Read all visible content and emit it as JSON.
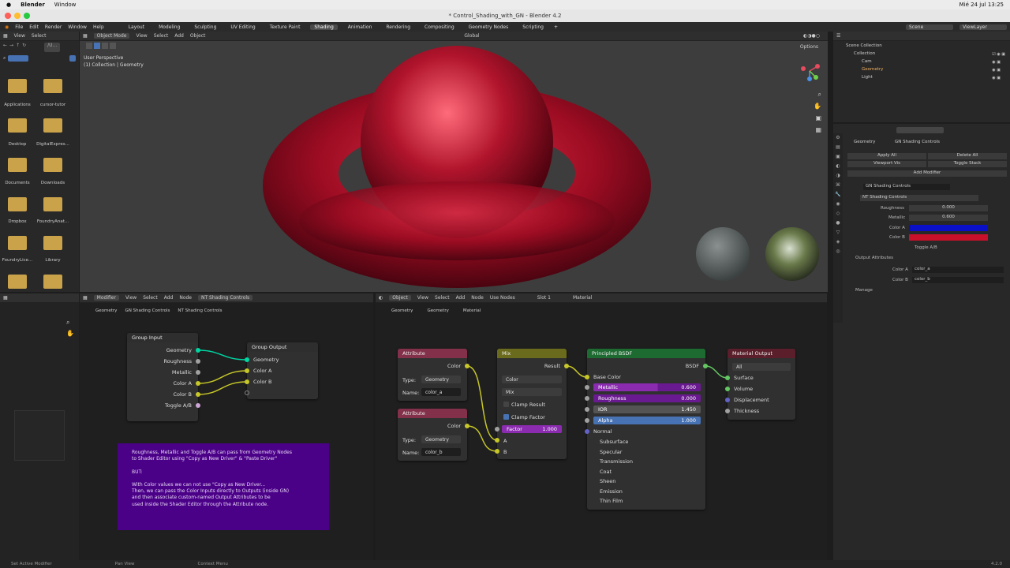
{
  "mac": {
    "apple": "",
    "app": "Blender",
    "window": "Window",
    "datetime": "Mié 24 jul 13:25"
  },
  "window_title": "* Control_Shading_with_GN - Blender 4.2",
  "menu": [
    "File",
    "Edit",
    "Render",
    "Window",
    "Help"
  ],
  "workspaces": [
    "Layout",
    "Modeling",
    "Sculpting",
    "UV Editing",
    "Texture Paint",
    "Shading",
    "Animation",
    "Rendering",
    "Compositing",
    "Geometry Nodes",
    "Scripting"
  ],
  "active_workspace": "Shading",
  "topright": {
    "scene": "Scene",
    "view_layer": "ViewLayer"
  },
  "filebrowser": {
    "view": "View",
    "select": "Select",
    "path": "/U...",
    "items": [
      "Applications",
      "cursor-tutor",
      "Desktop",
      "DigitalExpres...",
      "Documents",
      "Downloads",
      "Dropbox",
      "FoundryAnat...",
      "FoundryLice...",
      "Library"
    ]
  },
  "viewport": {
    "mode": "Object Mode",
    "menus": [
      "View",
      "Select",
      "Add",
      "Object"
    ],
    "transform": "Global",
    "info1": "User Perspective",
    "info2": "(1) Collection | Geometry",
    "options": "Options"
  },
  "outliner": {
    "root": "Scene Collection",
    "collection": "Collection",
    "items": [
      "Cam",
      "Geometry",
      "Light"
    ]
  },
  "properties": {
    "breadcrumb1": "Geometry",
    "breadcrumb2": "GN Shading Controls",
    "apply_all": "Apply All",
    "delete_all": "Delete All",
    "viewport_vis": "Viewport Vis",
    "toggle_stack": "Toggle Stack",
    "add_modifier": "Add Modifier",
    "modifier": "GN Shading Controls",
    "nodegroup": "NT Shading Controls",
    "roughness_label": "Roughness",
    "roughness": "0.000",
    "metallic_label": "Metallic",
    "metallic": "0.600",
    "color_a": "Color A",
    "color_b": "Color B",
    "toggle": "Toggle A/B",
    "output_attrs": "Output Attributes",
    "out_a_label": "Color A",
    "out_a": "color_a",
    "out_b_label": "Color B",
    "out_b": "color_b",
    "manage": "Manage",
    "color_a_hex": "#0a10c8",
    "color_b_hex": "#c8102a"
  },
  "geo_editor": {
    "header": [
      "Modifier",
      "View",
      "Select",
      "Add",
      "Node"
    ],
    "tree": "NT Shading Controls",
    "breadcrumb": [
      "Geometry",
      "GN Shading Controls",
      "NT Shading Controls"
    ],
    "group_input": {
      "title": "Group Input",
      "outs": [
        "Geometry",
        "Roughness",
        "Metallic",
        "Color A",
        "Color B",
        "Toggle A/B"
      ]
    },
    "group_output": {
      "title": "Group Output",
      "ins": [
        "Geometry",
        "Color A",
        "Color B"
      ]
    },
    "note": [
      "Roughness, Metallic and Toggle A/B can pass from Geometry Nodes",
      "to Shader Editor using \"Copy as New Driver\" & \"Paste Driver\"",
      "",
      "BUT:",
      "",
      "With Color values we can not use \"Copy as New Driver...",
      "Then, we can pass the Color Inputs directly to Outputs (inside GN)",
      "and then associate custom-named Output Attributes to be",
      "used inside the Shader Editor through the Attribute node."
    ]
  },
  "shader_editor": {
    "header": [
      "Object",
      "View",
      "Select",
      "Add",
      "Node"
    ],
    "use_nodes": "Use Nodes",
    "slot": "Slot 1",
    "material": "Material",
    "breadcrumb": [
      "Geometry",
      "Geometry",
      "Material"
    ],
    "attr1": {
      "title": "Attribute",
      "out": "Color",
      "type_label": "Type:",
      "type": "Geometry",
      "name_label": "Name:",
      "name": "color_a"
    },
    "attr2": {
      "title": "Attribute",
      "out": "Color",
      "type_label": "Type:",
      "type": "Geometry",
      "name_label": "Name:",
      "name": "color_b"
    },
    "mix": {
      "title": "Mix",
      "out": "Result",
      "dtype": "Color",
      "blend": "Mix",
      "clamp_result": "Clamp Result",
      "clamp_factor": "Clamp Factor",
      "factor_label": "Factor",
      "factor": "1.000",
      "a": "A",
      "b": "B"
    },
    "bsdf": {
      "title": "Principled BSDF",
      "out": "BSDF",
      "base_color": "Base Color",
      "metallic_label": "Metallic",
      "metallic": "0.600",
      "roughness_label": "Roughness",
      "roughness": "0.000",
      "ior_label": "IOR",
      "ior": "1.450",
      "alpha_label": "Alpha",
      "alpha": "1.000",
      "normal": "Normal",
      "panels": [
        "Subsurface",
        "Specular",
        "Transmission",
        "Coat",
        "Sheen",
        "Emission",
        "Thin Film"
      ]
    },
    "matout": {
      "title": "Material Output",
      "target": "All",
      "ins": [
        "Surface",
        "Volume",
        "Displacement",
        "Thickness"
      ]
    }
  },
  "status": {
    "left": "Set Active Modifier",
    "mid": "Pan View",
    "right": "Context Menu",
    "version": "4.2.0"
  }
}
